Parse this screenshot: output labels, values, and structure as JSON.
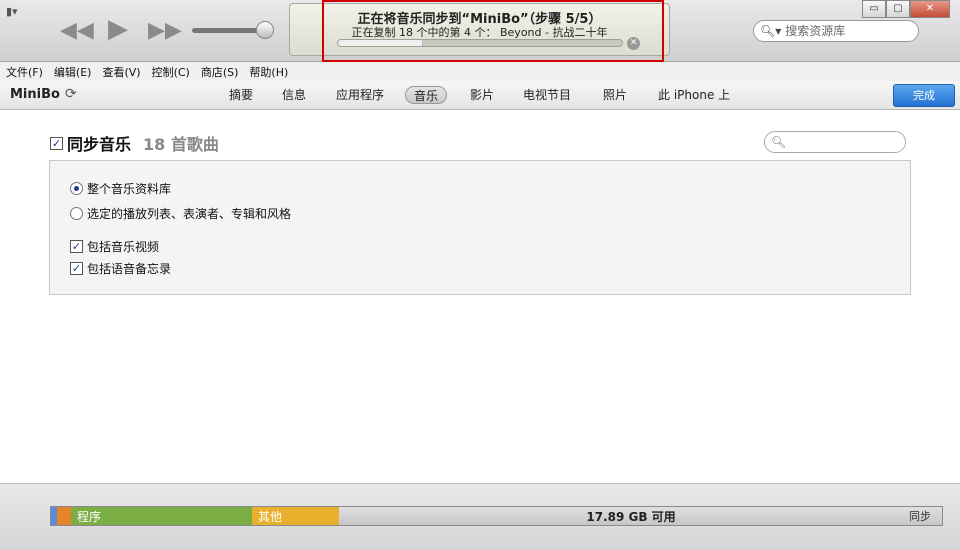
{
  "toolbar": {
    "lcd_title": "正在将音乐同步到“MiniBo”（步骤 5/5）",
    "lcd_detail": "正在复制 18 个中的第 4 个：  Beyond - 抗战二十年",
    "progress_fraction": 0.3,
    "search_placeholder": "搜索资源库"
  },
  "menu": [
    "文件(F)",
    "编辑(E)",
    "查看(V)",
    "控制(C)",
    "商店(S)",
    "帮助(H)"
  ],
  "device": {
    "name": "MiniBo",
    "tabs": [
      "摘要",
      "信息",
      "应用程序",
      "音乐",
      "影片",
      "电视节目",
      "照片",
      "此 iPhone 上"
    ],
    "active_tab": "音乐",
    "done_label": "完成"
  },
  "music": {
    "sync_label": "同步音乐",
    "song_count": "18 首歌曲",
    "option_entire": "整个音乐资料库",
    "option_selected": "选定的播放列表、表演者、专辑和风格",
    "include_videos": "包括音乐视频",
    "include_memos": "包括语音备忘录"
  },
  "capacity": {
    "segments": [
      {
        "label": "",
        "color": "#5b8bd6",
        "fraction": 0.006
      },
      {
        "label": "",
        "color": "#e8832a",
        "fraction": 0.016
      },
      {
        "label": "程序",
        "color": "#7aae45",
        "fraction": 0.203
      },
      {
        "label": "其他",
        "color": "#e9b02d",
        "fraction": 0.098
      }
    ],
    "free_label": "17.89 GB 可用",
    "sync_label": "同步"
  },
  "colors": {
    "accent": "#2372d4",
    "highlight_box": "#d00000"
  }
}
